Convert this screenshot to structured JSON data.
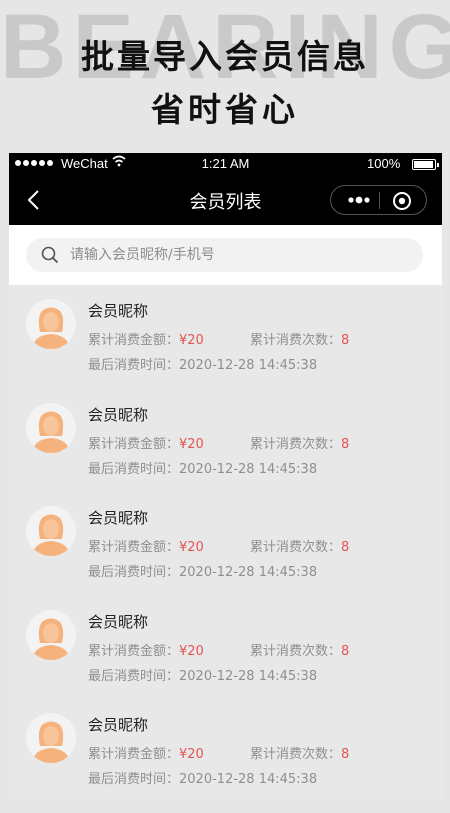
{
  "promo": {
    "watermark": "BEARING",
    "line1": "批量导入会员信息",
    "line2": "省时省心"
  },
  "statusbar": {
    "carrier": "WeChat",
    "time": "1:21 AM",
    "battery": "100%"
  },
  "navbar": {
    "title": "会员列表"
  },
  "search": {
    "placeholder": "请输入会员昵称/手机号"
  },
  "colors": {
    "accent": "#e25555",
    "avatar": "#f5b27d",
    "navbar": "#000000"
  },
  "members": [
    {
      "name": "会员昵称",
      "amount_label": "累计消费金额：",
      "amount": "¥20",
      "count_label": "累计消费次数：",
      "count": "8",
      "last_label": "最后消费时间：",
      "last_time": "2020-12-28 14:45:38"
    },
    {
      "name": "会员昵称",
      "amount_label": "累计消费金额：",
      "amount": "¥20",
      "count_label": "累计消费次数：",
      "count": "8",
      "last_label": "最后消费时间：",
      "last_time": "2020-12-28 14:45:38"
    },
    {
      "name": "会员昵称",
      "amount_label": "累计消费金额：",
      "amount": "¥20",
      "count_label": "累计消费次数：",
      "count": "8",
      "last_label": "最后消费时间：",
      "last_time": "2020-12-28 14:45:38"
    },
    {
      "name": "会员昵称",
      "amount_label": "累计消费金额：",
      "amount": "¥20",
      "count_label": "累计消费次数：",
      "count": "8",
      "last_label": "最后消费时间：",
      "last_time": "2020-12-28 14:45:38"
    },
    {
      "name": "会员昵称",
      "amount_label": "累计消费金额：",
      "amount": "¥20",
      "count_label": "累计消费次数：",
      "count": "8",
      "last_label": "最后消费时间：",
      "last_time": "2020-12-28 14:45:38"
    }
  ]
}
